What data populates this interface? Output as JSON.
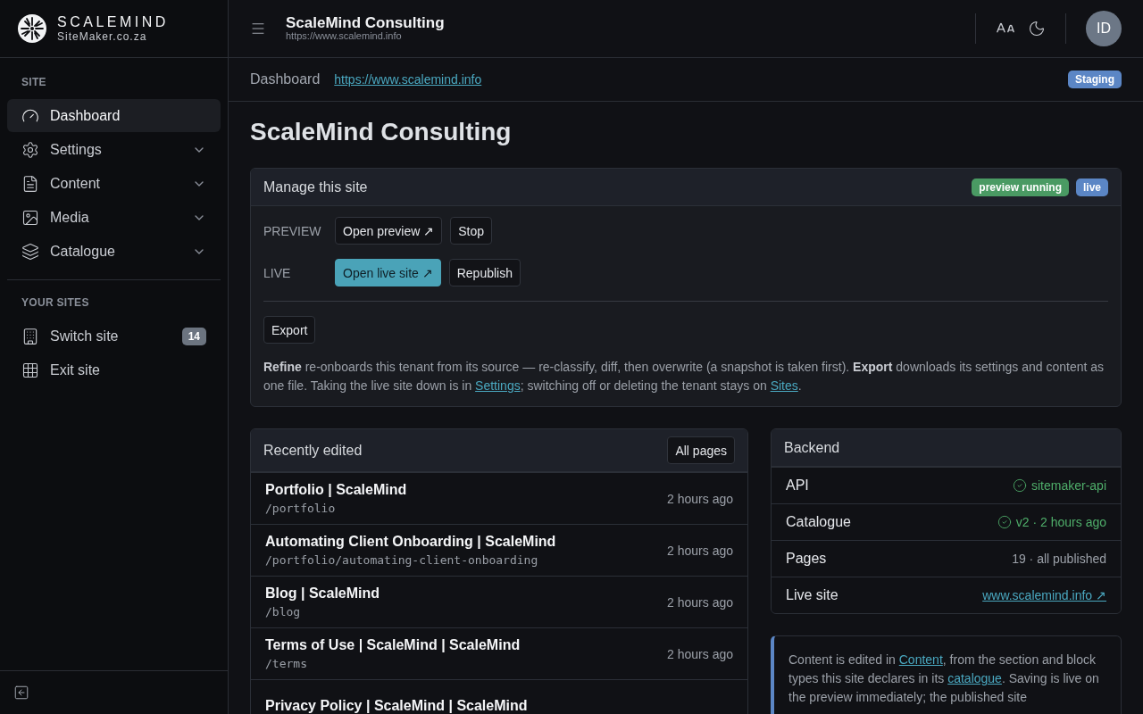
{
  "brand": {
    "name": "SCALEMIND",
    "domain": "SiteMaker.co.za"
  },
  "header": {
    "title": "ScaleMind Consulting",
    "url": "https://www.scalemind.info",
    "avatar": "ID"
  },
  "sidebar": {
    "sections": [
      {
        "heading": "SITE",
        "items": [
          {
            "label": "Dashboard",
            "kind": "link",
            "selected": true
          },
          {
            "label": "Settings",
            "kind": "group",
            "selected": false,
            "expanded": false
          },
          {
            "label": "Content",
            "kind": "group",
            "selected": false,
            "expanded": false
          },
          {
            "label": "Media",
            "kind": "group",
            "selected": false,
            "expanded": false
          },
          {
            "label": "Catalogue",
            "kind": "group",
            "selected": false,
            "expanded": false
          }
        ]
      },
      {
        "heading": "YOUR SITES",
        "items": [
          {
            "label": "Switch site",
            "kind": "link",
            "selected": false,
            "count": "14"
          },
          {
            "label": "Exit site",
            "kind": "link",
            "selected": false
          }
        ]
      }
    ]
  },
  "breadcrumb": {
    "label": "Dashboard",
    "url": "https://www.scalemind.info",
    "badge": "Staging"
  },
  "page_title": "ScaleMind Consulting",
  "manage": {
    "title": "Manage this site",
    "badges": [
      {
        "label": "preview running",
        "color": "#4a9a63"
      },
      {
        "label": "live",
        "color": "#5b86c5"
      }
    ],
    "rows": [
      {
        "label": "PREVIEW",
        "buttons": [
          {
            "label": "Open preview ↗",
            "primary": false
          },
          {
            "label": "Stop",
            "primary": false
          }
        ]
      },
      {
        "label": "LIVE",
        "buttons": [
          {
            "label": "Open live site ↗",
            "primary": true
          },
          {
            "label": "Republish",
            "primary": false
          }
        ]
      }
    ],
    "export_button": "Export",
    "note": [
      {
        "kind": "text",
        "text": "**Refine** re-onboards this tenant from its source — re-classify, diff, then overwrite (a snapshot is taken first). **Export** downloads its settings and content as one file. Taking the live site down is in "
      },
      {
        "kind": "link",
        "text": "Settings"
      },
      {
        "kind": "text",
        "text": "; switching off or deleting the tenant stays on "
      },
      {
        "kind": "link",
        "text": "Sites"
      },
      {
        "kind": "text",
        "text": "."
      }
    ]
  },
  "recent": {
    "title": "Recently edited",
    "button": "All pages",
    "rows": [
      {
        "title": "Portfolio | ScaleMind",
        "path": "/portfolio",
        "time": "2 hours ago"
      },
      {
        "title": "Automating Client Onboarding | ScaleMind",
        "path": "/portfolio/automating-client-onboarding",
        "time": "2 hours ago"
      },
      {
        "title": "Blog | ScaleMind",
        "path": "/blog",
        "time": "2 hours ago"
      },
      {
        "title": "Terms of Use | ScaleMind | ScaleMind",
        "path": "/terms",
        "time": "2 hours ago"
      },
      {
        "title": "Privacy Policy | ScaleMind | ScaleMind"
      }
    ]
  },
  "backend": {
    "title": "Backend",
    "rows": [
      {
        "label": "API",
        "value": "sitemaker-api",
        "kind": "ok"
      },
      {
        "label": "Catalogue",
        "value": "v2 · 2 hours ago",
        "kind": "ok"
      },
      {
        "label": "Pages",
        "value": "19 · all published",
        "kind": "text"
      },
      {
        "label": "Live site",
        "value": "www.scalemind.info ↗",
        "kind": "link"
      }
    ]
  },
  "info_note": [
    {
      "kind": "text",
      "text": "Content is edited in "
    },
    {
      "kind": "link",
      "text": "Content"
    },
    {
      "kind": "text",
      "text": ", from the section and block types this site declares in its "
    },
    {
      "kind": "link",
      "text": "catalogue"
    },
    {
      "kind": "text",
      "text": ". Saving is live on the preview immediately; the published site"
    }
  ]
}
